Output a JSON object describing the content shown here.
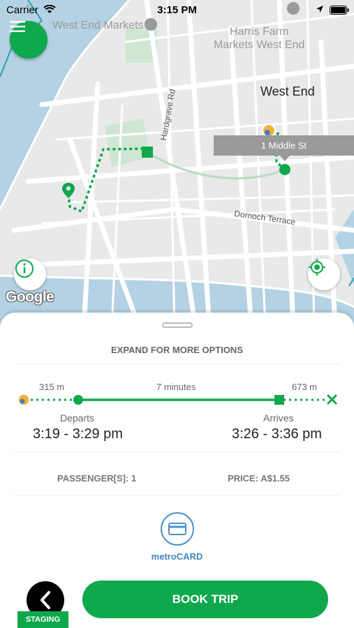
{
  "status_bar": {
    "carrier": "Carrier",
    "time": "3:15 PM"
  },
  "map": {
    "area_label": "West End",
    "poi_west_end_markets": "West End Markets",
    "poi_harris_farm_line1": "Harris Farm",
    "poi_harris_farm_line2": "Markets West End",
    "street_hardgrave": "Hardgrave Rd",
    "street_dornoch": "Dornoch Terrace",
    "destination_callout": "1 Middle St",
    "attribution": "Google"
  },
  "sheet": {
    "expand_label": "EXPAND FOR MORE OPTIONS",
    "walk_to_pickup": "315 m",
    "ride_duration": "7 minutes",
    "walk_from_dropoff": "673 m",
    "departs_label": "Departs",
    "departs_time": "3:19 - 3:29 pm",
    "arrives_label": "Arrives",
    "arrives_time": "3:26 - 3:36 pm",
    "passengers": "PASSENGER[S]:  1",
    "price": "PRICE:  A$1.55",
    "payment_method": "metroCARD",
    "book_button": "BOOK TRIP",
    "env_badge": "STAGING"
  },
  "colors": {
    "brand_green": "#10a84c",
    "payment_blue": "#3d86c2",
    "map_water": "#b4d2e3"
  },
  "icons": [
    "menu-icon",
    "info-icon",
    "locate-icon",
    "card-icon",
    "back-chevron-icon",
    "wifi-icon",
    "location-arrow-icon",
    "battery-icon",
    "avatar-icon",
    "map-pin-icon",
    "close-x-icon"
  ]
}
